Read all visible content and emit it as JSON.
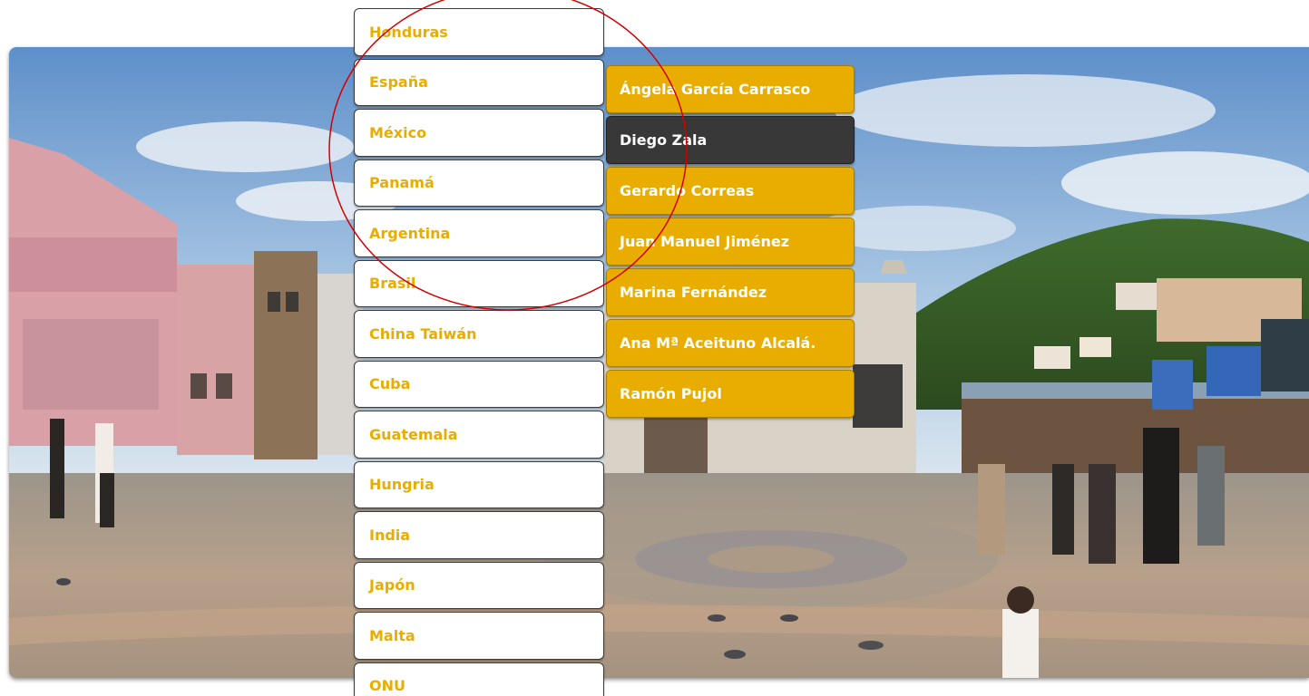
{
  "countries": [
    {
      "label": "Honduras"
    },
    {
      "label": "España"
    },
    {
      "label": "México"
    },
    {
      "label": "Panamá"
    },
    {
      "label": "Argentina"
    },
    {
      "label": "Brasil"
    },
    {
      "label": "China Taiwán"
    },
    {
      "label": "Cuba"
    },
    {
      "label": "Guatemala"
    },
    {
      "label": "Hungria"
    },
    {
      "label": "India"
    },
    {
      "label": "Japón"
    },
    {
      "label": "Malta"
    },
    {
      "label": "ONU"
    }
  ],
  "people": [
    {
      "label": "Ángela García Carrasco"
    },
    {
      "label": "Diego Zala",
      "active": true
    },
    {
      "label": "Gerardo Correas"
    },
    {
      "label": "Juan Manuel Jiménez"
    },
    {
      "label": "Marina Fernández"
    },
    {
      "label": "Ana Mª Aceituno Alcalá."
    },
    {
      "label": "Ramón Pujol"
    }
  ],
  "colors": {
    "accent": "#e8ad00",
    "active_item": "#383838",
    "annotation": "#d40000"
  }
}
